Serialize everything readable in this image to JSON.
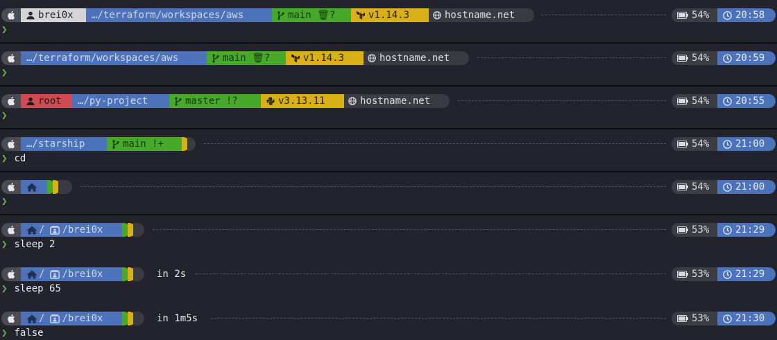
{
  "os_icon": "apple-icon",
  "battery_icon": "battery-icon",
  "clock_icon": "clock-icon",
  "chevron": "❯",
  "rows": [
    {
      "user": "brei0x",
      "dir": "…/terraform/workspaces/aws",
      "git": "main 🗑?",
      "lang": "v1.14.3",
      "host": "hostname.net",
      "battery": "54%",
      "time": "20:58",
      "input": ""
    },
    {
      "dir": "…/terraform/workspaces/aws",
      "git": "main 🗑?",
      "lang": "v1.14.3",
      "host": "hostname.net",
      "battery": "54%",
      "time": "20:59",
      "input": ""
    },
    {
      "user": "root",
      "dir": "…/py-project",
      "git": "master !?",
      "lang": "v3.13.11",
      "host": "hostname.net",
      "battery": "54%",
      "time": "20:55",
      "input": ""
    },
    {
      "dir": "…/starship",
      "git": "main !+",
      "battery": "54%",
      "time": "21:00",
      "input": "cd"
    },
    {
      "battery": "54%",
      "time": "21:00",
      "input": ""
    },
    {
      "dir_home": "/",
      "dir_user": "/brei0x",
      "battery": "53%",
      "time": "21:29",
      "input": "sleep 2"
    },
    {
      "dir_home": "/",
      "dir_user": "/brei0x",
      "duration": "in 2s",
      "battery": "53%",
      "time": "21:29",
      "input": "sleep 65"
    },
    {
      "dir_home": "/",
      "dir_user": "/brei0x",
      "duration": "in 1m5s",
      "battery": "53%",
      "time": "21:30",
      "input": "false"
    }
  ]
}
